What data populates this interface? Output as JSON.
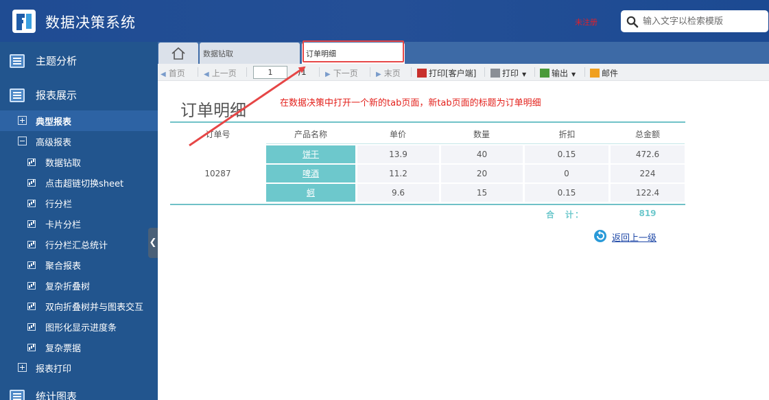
{
  "header": {
    "title": "数据决策系统",
    "unregistered": "未注册",
    "search_placeholder": "输入文字以检索模版",
    "logo_icon": "fr-logo-icon",
    "search_icon": "search-icon"
  },
  "sidebar": {
    "sections": [
      {
        "label": "主题分析",
        "icon": "report-list-icon"
      },
      {
        "label": "报表展示",
        "icon": "report-list-icon"
      },
      {
        "label": "统计图表",
        "icon": "report-list-icon"
      }
    ],
    "folders": [
      {
        "label": "典型报表",
        "expanded": false,
        "selected": true
      },
      {
        "label": "高级报表",
        "expanded": true,
        "selected": false
      },
      {
        "label": "报表打印",
        "expanded": false,
        "selected": false
      }
    ],
    "items": [
      {
        "label": "数据钻取"
      },
      {
        "label": "点击超链切换sheet"
      },
      {
        "label": "行分栏"
      },
      {
        "label": "卡片分栏"
      },
      {
        "label": "行分栏汇总统计"
      },
      {
        "label": "聚合报表"
      },
      {
        "label": "复杂折叠树"
      },
      {
        "label": "双向折叠树并与图表交互"
      },
      {
        "label": "图形化显示进度条"
      },
      {
        "label": "复杂票据"
      }
    ],
    "collapse_icon": "chevron-left-icon"
  },
  "tabs": {
    "home_icon": "home-icon",
    "items": [
      {
        "label": "数据钻取",
        "active": false
      },
      {
        "label": "订单明细",
        "active": true
      }
    ]
  },
  "toolbar": {
    "first": "首页",
    "prev": "上一页",
    "page_value": "1",
    "page_total": "/1",
    "next": "下一页",
    "last": "末页",
    "print_client": "打印[客户端]",
    "print": "打印",
    "export": "输出",
    "mail": "邮件"
  },
  "report": {
    "title": "订单明细",
    "columns": [
      "订单号",
      "产品名称",
      "单价",
      "数量",
      "折扣",
      "总金额"
    ],
    "order_no": "10287",
    "rows": [
      {
        "product": "饼干",
        "price": "13.9",
        "qty": "40",
        "discount": "0.15",
        "amount": "472.6"
      },
      {
        "product": "啤酒",
        "price": "11.2",
        "qty": "20",
        "discount": "0",
        "amount": "224"
      },
      {
        "product": "蚵",
        "price": "9.6",
        "qty": "15",
        "discount": "0.15",
        "amount": "122.4"
      }
    ],
    "total_label": "合　计：",
    "total_value": "819",
    "back_label": "返回上一级"
  },
  "annotation": {
    "text": "在数据决策中打开一个新的tab页面，新tab页面的标题为订单明细",
    "color": "#e3201b"
  },
  "colors": {
    "header_bg": "#1f4c93",
    "sidebar_bg": "#22558e",
    "teal_accent": "#6dc8cc",
    "highlight_red": "#e64646"
  }
}
